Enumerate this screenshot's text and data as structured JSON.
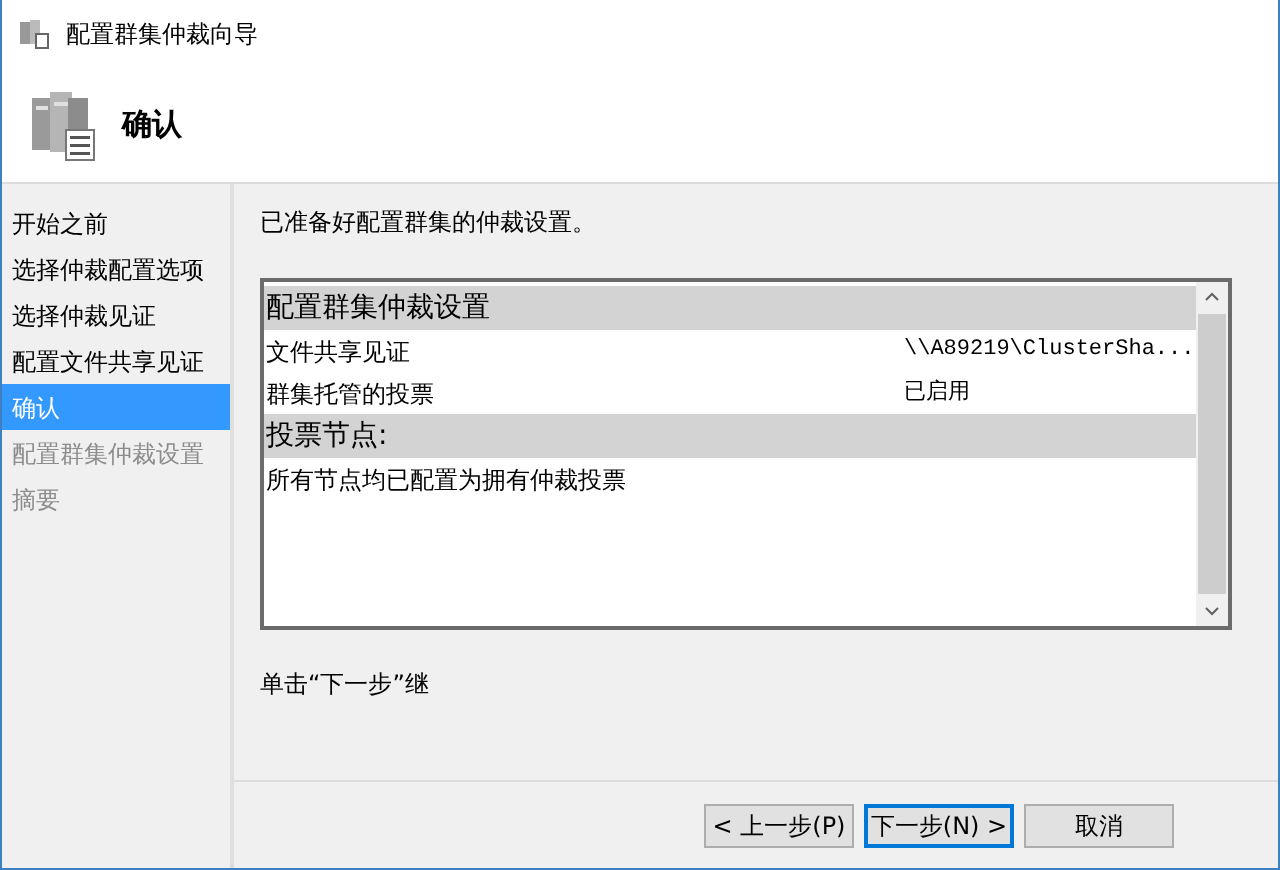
{
  "window": {
    "title": "配置群集仲裁向导"
  },
  "header": {
    "title": "确认"
  },
  "steps": [
    {
      "label": "开始之前",
      "selected": false,
      "disabled": false
    },
    {
      "label": "选择仲裁配置选项",
      "selected": false,
      "disabled": false
    },
    {
      "label": "选择仲裁见证",
      "selected": false,
      "disabled": false
    },
    {
      "label": "配置文件共享见证",
      "selected": false,
      "disabled": false
    },
    {
      "label": "确认",
      "selected": true,
      "disabled": false
    },
    {
      "label": "配置群集仲裁设置",
      "selected": false,
      "disabled": true
    },
    {
      "label": "摘要",
      "selected": false,
      "disabled": true
    }
  ],
  "intro": "已准备好配置群集的仲裁设置。",
  "report": [
    {
      "kind": "heading",
      "text": "配置群集仲裁设置"
    },
    {
      "kind": "pair",
      "name": "文件共享见证",
      "value": "\\\\A89219\\ClusterSha..."
    },
    {
      "kind": "pair",
      "name": "群集托管的投票",
      "value": "已启用"
    },
    {
      "kind": "heading",
      "text": "投票节点:"
    },
    {
      "kind": "line",
      "text": "所有节点均已配置为拥有仲裁投票"
    }
  ],
  "hint": "单击“下一步”继",
  "buttons": [
    {
      "label": "< 上一步(P)",
      "selected": false
    },
    {
      "label": "下一步(N) >",
      "selected": true
    },
    {
      "label": "取消",
      "selected": false
    }
  ]
}
